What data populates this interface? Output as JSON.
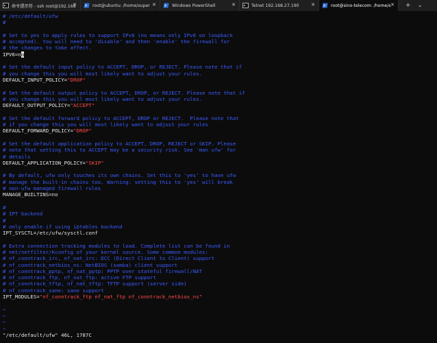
{
  "tabs": [
    {
      "label": "命令提示符 - ssh  root@192.168",
      "icon": "cmd-icon",
      "active": false
    },
    {
      "label": "root@ubuntu: /home/super",
      "icon": "powershell-icon",
      "active": false
    },
    {
      "label": "Windows PowerShell",
      "icon": "powershell-icon",
      "active": false
    },
    {
      "label": "Telnet 192.168.27.190",
      "icon": "cmd-icon",
      "active": false
    },
    {
      "label": "root@sino-telecom: /home/s",
      "icon": "powershell-icon",
      "active": true
    }
  ],
  "tab_tools": {
    "new_tab": "+",
    "dropdown": "⌄"
  },
  "terminal": {
    "lines": [
      {
        "segments": [
          {
            "t": "# /etc/default/ufw",
            "c": "comment"
          }
        ]
      },
      {
        "segments": [
          {
            "t": "#",
            "c": "comment"
          }
        ]
      },
      {
        "segments": []
      },
      {
        "segments": [
          {
            "t": "# Set to yes to apply rules to support IPv6 (no means only IPv6 on loopback",
            "c": "comment"
          }
        ]
      },
      {
        "segments": [
          {
            "t": "# accepted). You will need to 'disable' and then 'enable' the firewall for",
            "c": "comment"
          }
        ]
      },
      {
        "segments": [
          {
            "t": "# the changes to take affect.",
            "c": "comment"
          }
        ]
      },
      {
        "segments": [
          {
            "t": "IPV6=n",
            "c": ""
          },
          {
            "t": "o",
            "c": "cursor"
          }
        ]
      },
      {
        "segments": []
      },
      {
        "segments": [
          {
            "t": "# Set the default input policy to ACCEPT, DROP, or REJECT. Please note that if",
            "c": "comment"
          }
        ]
      },
      {
        "segments": [
          {
            "t": "# you change this you will most likely want to adjust your rules.",
            "c": "comment"
          }
        ]
      },
      {
        "segments": [
          {
            "t": "DEFAULT_INPUT_POLICY=",
            "c": ""
          },
          {
            "t": "\"DROP\"",
            "c": "str"
          }
        ]
      },
      {
        "segments": []
      },
      {
        "segments": [
          {
            "t": "# Set the default output policy to ACCEPT, DROP, or REJECT. Please note that if",
            "c": "comment"
          }
        ]
      },
      {
        "segments": [
          {
            "t": "# you change this you will most likely want to adjust your rules.",
            "c": "comment"
          }
        ]
      },
      {
        "segments": [
          {
            "t": "DEFAULT_OUTPUT_POLICY=",
            "c": ""
          },
          {
            "t": "\"ACCEPT\"",
            "c": "str"
          }
        ]
      },
      {
        "segments": []
      },
      {
        "segments": [
          {
            "t": "# Set the default forward policy to ACCEPT, DROP or REJECT.  Please note that",
            "c": "comment"
          }
        ]
      },
      {
        "segments": [
          {
            "t": "# if you change this you will most likely want to adjust your rules",
            "c": "comment"
          }
        ]
      },
      {
        "segments": [
          {
            "t": "DEFAULT_FORWARD_POLICY=",
            "c": ""
          },
          {
            "t": "\"DROP\"",
            "c": "str"
          }
        ]
      },
      {
        "segments": []
      },
      {
        "segments": [
          {
            "t": "# Set the default application policy to ACCEPT, DROP, REJECT or SKIP. Please",
            "c": "comment"
          }
        ]
      },
      {
        "segments": [
          {
            "t": "# note that setting this to ACCEPT may be a security risk. See 'man ufw' for",
            "c": "comment"
          }
        ]
      },
      {
        "segments": [
          {
            "t": "# details",
            "c": "comment"
          }
        ]
      },
      {
        "segments": [
          {
            "t": "DEFAULT_APPLICATION_POLICY=",
            "c": ""
          },
          {
            "t": "\"SKIP\"",
            "c": "str"
          }
        ]
      },
      {
        "segments": []
      },
      {
        "segments": [
          {
            "t": "# By default, ufw only touches its own chains. Set this to 'yes' to have ufw",
            "c": "comment"
          }
        ]
      },
      {
        "segments": [
          {
            "t": "# manage the built-in chains too. Warning: setting this to 'yes' will break",
            "c": "comment"
          }
        ]
      },
      {
        "segments": [
          {
            "t": "# non-ufw managed firewall rules",
            "c": "comment"
          }
        ]
      },
      {
        "segments": [
          {
            "t": "MANAGE_BUILTINS=no",
            "c": ""
          }
        ]
      },
      {
        "segments": []
      },
      {
        "segments": [
          {
            "t": "#",
            "c": "comment"
          }
        ]
      },
      {
        "segments": [
          {
            "t": "# IPT backend",
            "c": "comment"
          }
        ]
      },
      {
        "segments": [
          {
            "t": "#",
            "c": "comment"
          }
        ]
      },
      {
        "segments": [
          {
            "t": "# only enable if using iptables backend",
            "c": "comment"
          }
        ]
      },
      {
        "segments": [
          {
            "t": "IPT_SYSCTL=/etc/ufw/sysctl.conf",
            "c": ""
          }
        ]
      },
      {
        "segments": []
      },
      {
        "segments": [
          {
            "t": "# Extra connection tracking modules to load. Complete list can be found in",
            "c": "comment"
          }
        ]
      },
      {
        "segments": [
          {
            "t": "# net/netfilter/Kconfig of your kernel source. Some common modules:",
            "c": "comment"
          }
        ]
      },
      {
        "segments": [
          {
            "t": "# nf_conntrack_irc, nf_nat_irc: DCC (Direct Client to Client) support",
            "c": "comment"
          }
        ]
      },
      {
        "segments": [
          {
            "t": "# nf_conntrack_netbios_ns: NetBIOS (samba) client support",
            "c": "comment"
          }
        ]
      },
      {
        "segments": [
          {
            "t": "# nf_conntrack_pptp, nf_nat_pptp: PPTP over stateful firewall/NAT",
            "c": "comment"
          }
        ]
      },
      {
        "segments": [
          {
            "t": "# nf_conntrack_ftp, nf_nat_ftp: active FTP support",
            "c": "comment"
          }
        ]
      },
      {
        "segments": [
          {
            "t": "# nf_conntrack_tftp, nf_nat_tftp: TFTP support (server side)",
            "c": "comment"
          }
        ]
      },
      {
        "segments": [
          {
            "t": "# nf_conntrack_sane: sane support",
            "c": "comment"
          }
        ]
      },
      {
        "segments": [
          {
            "t": "IPT_MODULES=",
            "c": ""
          },
          {
            "t": "\"nf_conntrack_ftp nf_nat_ftp nf_conntrack_netbios_ns\"",
            "c": "str"
          }
        ]
      },
      {
        "segments": []
      },
      {
        "segments": [
          {
            "t": "~",
            "c": "tilde"
          }
        ]
      },
      {
        "segments": [
          {
            "t": "~",
            "c": "tilde"
          }
        ]
      },
      {
        "segments": [
          {
            "t": "~",
            "c": "tilde"
          }
        ]
      },
      {
        "segments": [
          {
            "t": "~",
            "c": "tilde"
          }
        ]
      },
      {
        "segments": [
          {
            "t": "\"/etc/default/ufw\" 46L, 1787C",
            "c": ""
          }
        ]
      }
    ]
  },
  "colors": {
    "background": "#0c0c0c",
    "text": "#e6e6e6",
    "comment": "#3b5cff",
    "string": "#ff4b4b",
    "tabbar": "#1f1f1f"
  }
}
